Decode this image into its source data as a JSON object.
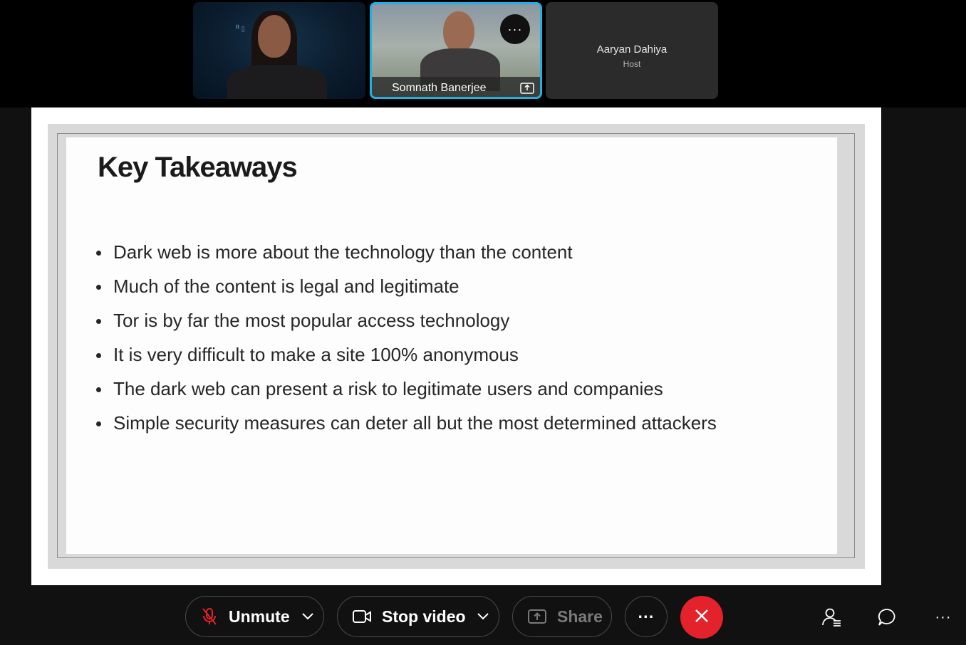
{
  "participants": [
    {
      "name": "",
      "background_text": "ᐦ▯ ᴜᴍᴍ"
    },
    {
      "name": "Somnath Banerjee",
      "more_label": "···"
    },
    {
      "name": "Aaryan Dahiya",
      "role": "Host"
    }
  ],
  "slide": {
    "title": "Key Takeaways",
    "bullets": [
      "Dark web is more about the technology than the content",
      "Much of the content is legal and legitimate",
      "Tor is by far the most popular access technology",
      "It is very difficult to make a site 100% anonymous",
      "The dark web can present a risk to legitimate users and companies",
      "Simple security measures can deter all but the most determined attackers"
    ]
  },
  "controls": {
    "unmute_label": "Unmute",
    "stop_video_label": "Stop video",
    "share_label": "Share",
    "more_label": "···",
    "overflow_label": "···"
  },
  "colors": {
    "active_speaker_border": "#1fb0e6",
    "end_call": "#e3222c",
    "mute_icon": "#e3222c"
  }
}
